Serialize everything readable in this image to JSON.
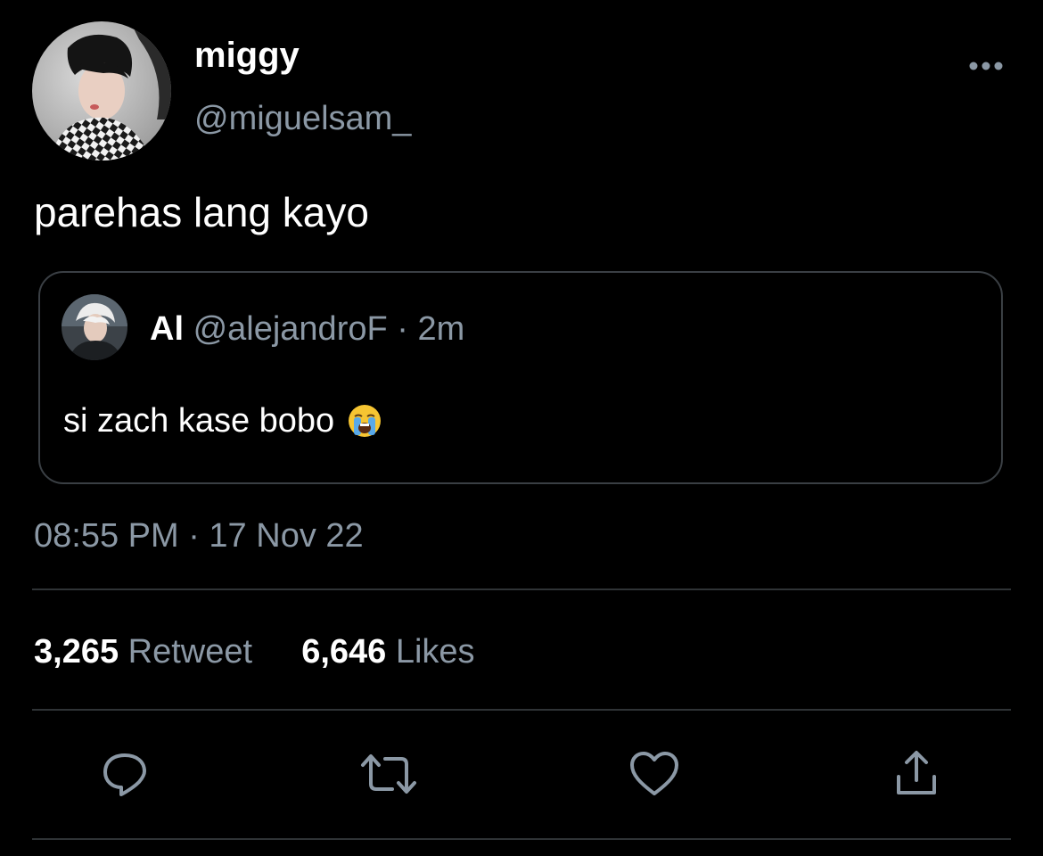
{
  "tweet": {
    "author": {
      "display_name": "miggy",
      "handle": "@miguelsam_"
    },
    "text": "parehas lang kayo",
    "quoted": {
      "display_name": "Al",
      "handle": "@alejandroF",
      "separator": "·",
      "time": "2m",
      "text": "si zach kase bobo",
      "emoji": "loudly-crying-face"
    },
    "timestamp": "08:55 PM · 17 Nov 22",
    "stats": {
      "retweets_count": "3,265",
      "retweets_label": "Retweet",
      "likes_count": "6,646",
      "likes_label": "Likes"
    }
  },
  "actions": {
    "reply_icon": "speech-bubble-icon",
    "retweet_icon": "retweet-arrows-icon",
    "like_icon": "heart-icon",
    "share_icon": "share-upload-icon"
  },
  "colors": {
    "background": "#000000",
    "primary_text": "#ffffff",
    "secondary_text": "#8b98a5",
    "border": "#2f3336"
  }
}
